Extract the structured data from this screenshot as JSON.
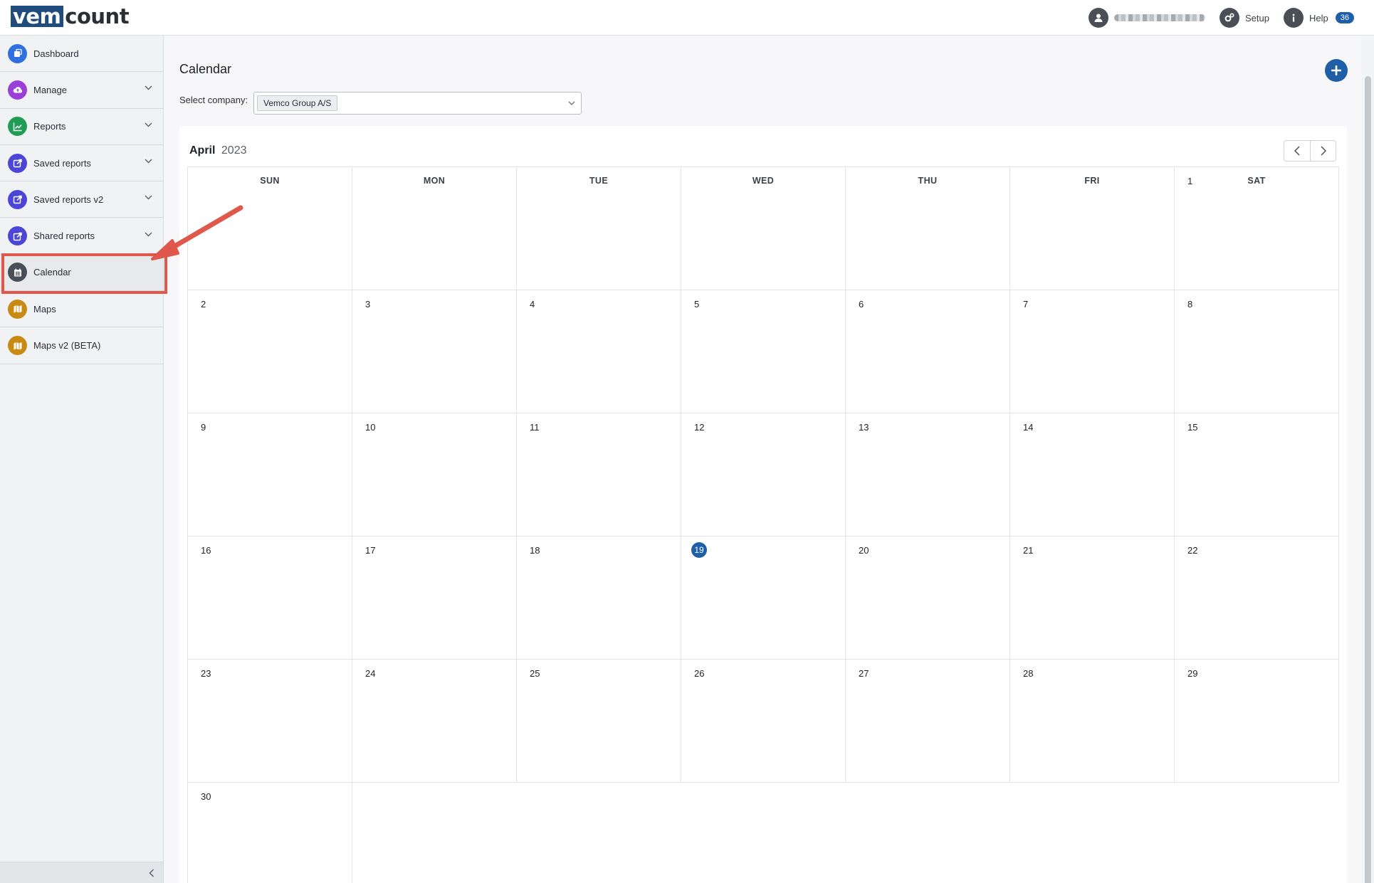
{
  "brand": {
    "part1": "vem",
    "part2": "count"
  },
  "topbar": {
    "setup_label": "Setup",
    "help_label": "Help",
    "help_count": "36"
  },
  "sidebar": {
    "items": [
      {
        "label": "Dashboard",
        "icon": "dashboard-icon",
        "color": "#2f6fe0",
        "has_chevron": false
      },
      {
        "label": "Manage",
        "icon": "cloud-upload-icon",
        "color": "#9b3fd9",
        "has_chevron": true
      },
      {
        "label": "Reports",
        "icon": "chart-icon",
        "color": "#1f9d55",
        "has_chevron": true
      },
      {
        "label": "Saved reports",
        "icon": "share-icon",
        "color": "#4b46d8",
        "has_chevron": true
      },
      {
        "label": "Saved reports v2",
        "icon": "share-icon",
        "color": "#4b46d8",
        "has_chevron": true
      },
      {
        "label": "Shared reports",
        "icon": "share-icon",
        "color": "#4b46d8",
        "has_chevron": true
      },
      {
        "label": "Calendar",
        "icon": "calendar-icon",
        "color": "#4a4f57",
        "has_chevron": false,
        "active": true
      },
      {
        "label": "Maps",
        "icon": "map-icon",
        "color": "#c98a14",
        "has_chevron": false
      },
      {
        "label": "Maps v2 (BETA)",
        "icon": "map-icon",
        "color": "#c98a14",
        "has_chevron": false
      }
    ]
  },
  "main": {
    "title": "Calendar",
    "company_label": "Select company:",
    "company_value": "Vemco Group A/S"
  },
  "calendar": {
    "month": "April",
    "year": "2023",
    "weekdays": [
      "SUN",
      "MON",
      "TUE",
      "WED",
      "THU",
      "FRI",
      "SAT"
    ],
    "today": "19",
    "weeks": [
      [
        "",
        "",
        "",
        "",
        "",
        "",
        "1"
      ],
      [
        "2",
        "3",
        "4",
        "5",
        "6",
        "7",
        "8"
      ],
      [
        "9",
        "10",
        "11",
        "12",
        "13",
        "14",
        "15"
      ],
      [
        "16",
        "17",
        "18",
        "19",
        "20",
        "21",
        "22"
      ],
      [
        "23",
        "24",
        "25",
        "26",
        "27",
        "28",
        "29"
      ],
      [
        "30",
        "",
        "",
        "",
        "",
        "",
        ""
      ]
    ]
  },
  "colors": {
    "accent": "#1f5fa8",
    "annotation": "#e0584b"
  }
}
